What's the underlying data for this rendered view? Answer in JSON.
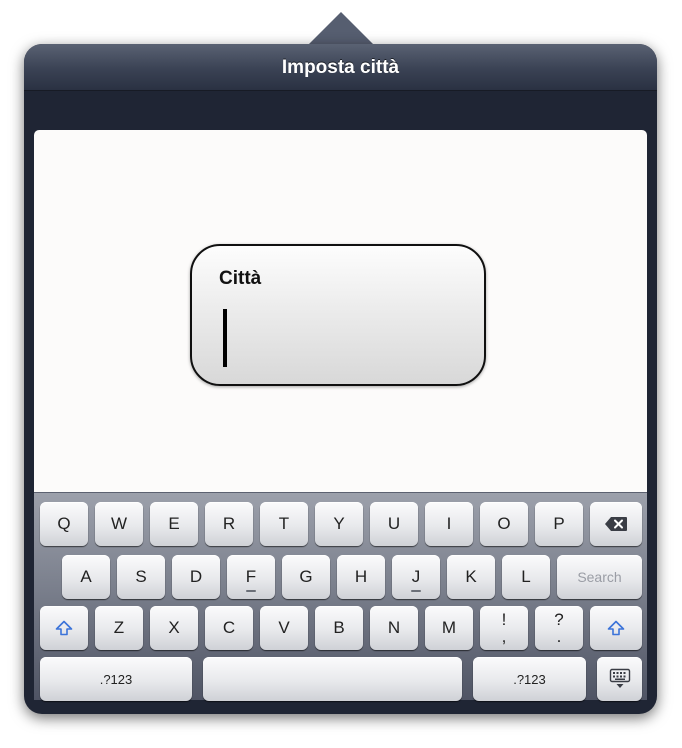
{
  "popover": {
    "title": "Imposta città"
  },
  "field": {
    "label": "Città",
    "value": ""
  },
  "keyboard": {
    "row1": [
      "Q",
      "W",
      "E",
      "R",
      "T",
      "Y",
      "U",
      "I",
      "O",
      "P"
    ],
    "row2": [
      "A",
      "S",
      "D",
      "F",
      "G",
      "H",
      "J",
      "K",
      "L"
    ],
    "row3": [
      "Z",
      "X",
      "C",
      "V",
      "B",
      "N",
      "M"
    ],
    "exclam": {
      "top": "!",
      "bottom": ","
    },
    "question": {
      "top": "?",
      "bottom": "."
    },
    "search_label": "Search",
    "numbers_left": ".?123",
    "numbers_right": ".?123",
    "icons": {
      "backspace": "backspace-icon",
      "shift": "shift-icon",
      "dismiss": "keyboard-dismiss-icon"
    },
    "accent_color": "#3b73d9"
  }
}
